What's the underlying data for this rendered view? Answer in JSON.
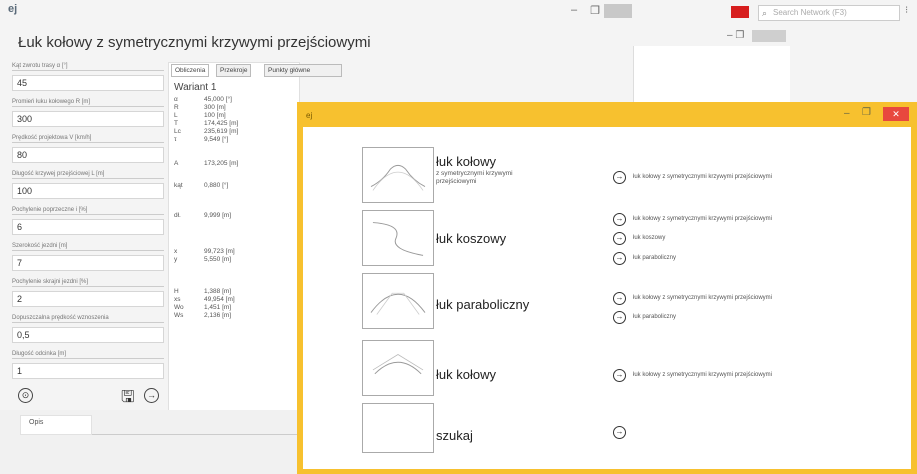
{
  "main": {
    "app_icon": "ej",
    "title": "Łuk kołowy z symetrycznymi krzywymi przejściowymi",
    "window_controls": {
      "minimize": "–",
      "maximize": "❐"
    },
    "search_placeholder": "Search Network (F3)",
    "menu_dots": "⁝",
    "sub_controls": "– ❐"
  },
  "form": {
    "fields": [
      {
        "label": "Kąt zwrotu trasy α [°]",
        "value": "45"
      },
      {
        "label": "Promień łuku kołowego R [m]",
        "value": "300"
      },
      {
        "label": "Prędkość projektowa V [km/h]",
        "value": "80"
      },
      {
        "label": "Długość krzywej przejściowej L [m]",
        "value": "100"
      },
      {
        "label": "Pochylenie poprzeczne i [%]",
        "value": "6"
      },
      {
        "label": "Szerokość jezdni [m]",
        "value": "7"
      },
      {
        "label": "Pochylenie skrajni jezdni [%]",
        "value": "2"
      },
      {
        "label": "Dopuszczalna prędkość wznoszenia",
        "value": "0,5"
      },
      {
        "label": "Długość odcinka [m]",
        "value": "1"
      }
    ]
  },
  "results": {
    "tabs": [
      "Obliczenia",
      "Przekroje",
      "Punkty główne"
    ],
    "heading": "Wariant 1",
    "rows": [
      {
        "k": "α",
        "v": "45,000 [°]"
      },
      {
        "k": "R",
        "v": "300 [m]"
      },
      {
        "k": "L",
        "v": "100 [m]"
      },
      {
        "k": "T",
        "v": "174,425 [m]"
      },
      {
        "k": "Lc",
        "v": "235,619 [m]"
      },
      {
        "k": "τ",
        "v": "9,549 [°]"
      },
      {
        "k": "A",
        "v": "173,205 [m]"
      },
      {
        "k": "kąt",
        "v": "0,880 [°]"
      },
      {
        "k": "dł.",
        "v": "9,999 [m]"
      },
      {
        "k": "x",
        "v": "99,723 [m]"
      },
      {
        "k": "y",
        "v": "5,550 [m]"
      },
      {
        "k": "H",
        "v": "1,388 [m]"
      },
      {
        "k": "xs",
        "v": "49,954 [m]"
      },
      {
        "k": "Wo",
        "v": "1,451 [m]"
      },
      {
        "k": "Ws",
        "v": "2,136 [m]"
      }
    ]
  },
  "bottom": {
    "description_label": "Opis"
  },
  "dialog": {
    "title_icon": "ej",
    "controls": {
      "minimize": "–",
      "maximize": "❐",
      "close": "✕"
    },
    "options": [
      {
        "title": "łuk kołowy",
        "subtitle": "z symetrycznymi krzywymi przejściowymi",
        "links": [
          "łuk kołowy z symetrycznymi krzywymi przejściowymi"
        ]
      },
      {
        "title": "łuk koszowy",
        "subtitle": "",
        "links": [
          "łuk kołowy z symetrycznymi krzywymi przejściowymi",
          "łuk koszowy",
          "łuk paraboliczny"
        ]
      },
      {
        "title": "łuk paraboliczny",
        "subtitle": "",
        "links": [
          "łuk kołowy z symetrycznymi krzywymi przejściowymi",
          "łuk paraboliczny"
        ]
      },
      {
        "title": "łuk kołowy",
        "subtitle": "",
        "links": [
          "łuk kołowy z symetrycznymi krzywymi przejściowymi"
        ]
      },
      {
        "title": "szukaj",
        "subtitle": "",
        "links": [
          ""
        ]
      }
    ]
  },
  "colors": {
    "dialog_frame": "#f7c12f",
    "close_red": "#e8483e",
    "taskbar_red": "#d71e1e"
  },
  "icons": {
    "arrow": "→",
    "save": "🖫",
    "calc": "⊙",
    "search": "⌕"
  }
}
